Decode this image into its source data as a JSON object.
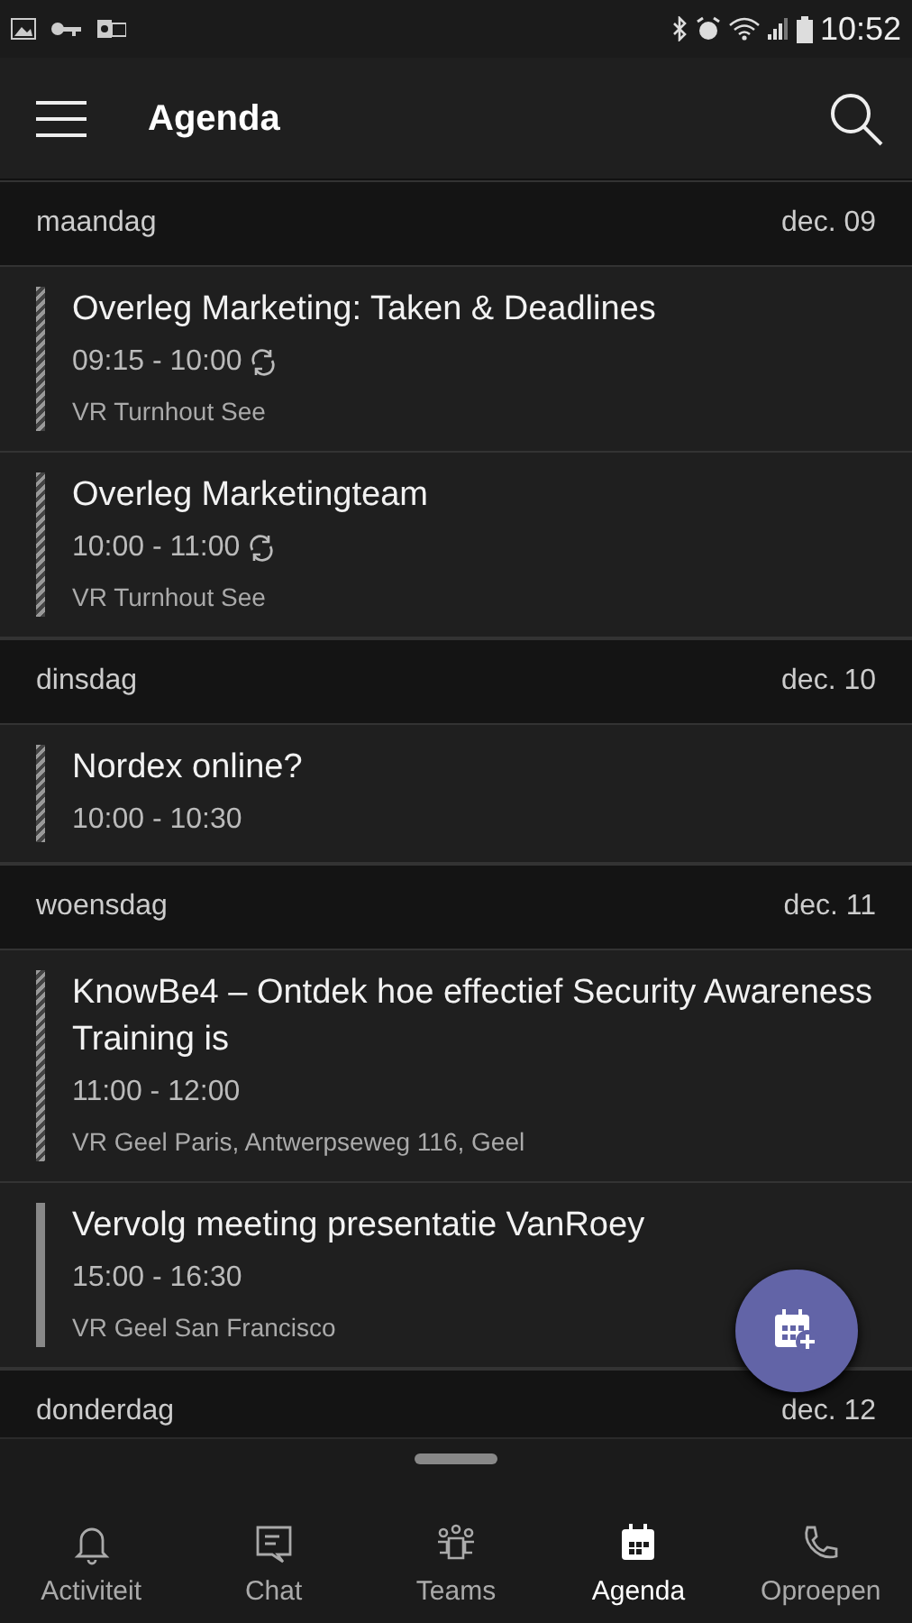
{
  "status_bar": {
    "time": "10:52"
  },
  "app_bar": {
    "title": "Agenda"
  },
  "days": [
    {
      "day": "maandag",
      "date": "dec. 09",
      "events": [
        {
          "title": "Overleg Marketing: Taken & Deadlines",
          "time": "09:15 - 10:00",
          "recurring": true,
          "location": "VR Turnhout See",
          "tentative": true
        },
        {
          "title": "Overleg Marketingteam",
          "time": "10:00 - 11:00",
          "recurring": true,
          "location": "VR Turnhout See",
          "tentative": true
        }
      ]
    },
    {
      "day": "dinsdag",
      "date": "dec. 10",
      "events": [
        {
          "title": "Nordex online?",
          "time": "10:00 - 10:30",
          "recurring": false,
          "tentative": true
        }
      ]
    },
    {
      "day": "woensdag",
      "date": "dec. 11",
      "events": [
        {
          "title": "KnowBe4 – Ontdek hoe effectief Security Awareness Training is",
          "time": "11:00 - 12:00",
          "recurring": false,
          "location": "VR Geel Paris, Antwerpseweg 116, Geel",
          "tentative": true
        },
        {
          "title": "Vervolg meeting presentatie VanRoey",
          "time": "15:00 - 16:30",
          "recurring": false,
          "location": "VR Geel San Francisco",
          "tentative": false
        }
      ]
    },
    {
      "day": "donderdag",
      "date": "dec. 12"
    }
  ],
  "bottom_nav": [
    {
      "label": "Activiteit",
      "selected": false
    },
    {
      "label": "Chat",
      "selected": false
    },
    {
      "label": "Teams",
      "selected": false
    },
    {
      "label": "Agenda",
      "selected": true
    },
    {
      "label": "Oproepen",
      "selected": false
    }
  ]
}
